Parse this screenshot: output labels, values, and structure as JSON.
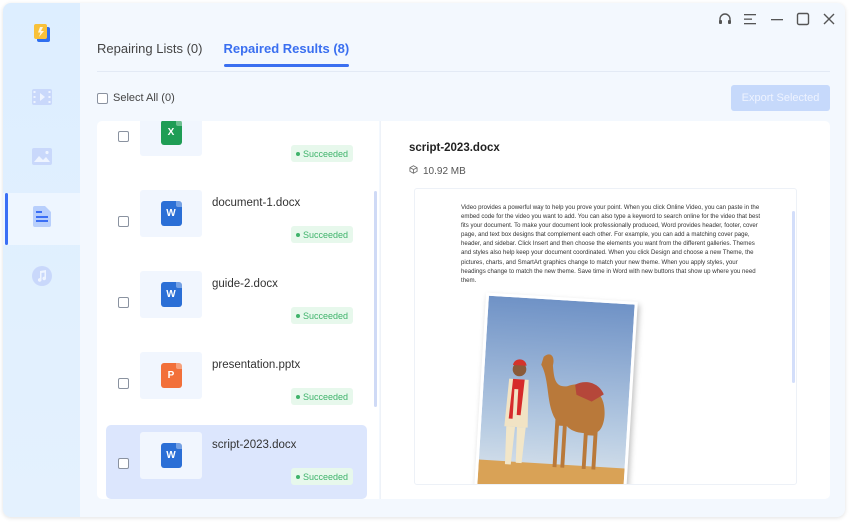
{
  "sidebar": {
    "items": [
      {
        "name": "app-logo",
        "icon": "app-logo-icon",
        "active": false
      },
      {
        "name": "video-repair",
        "icon": "film-icon",
        "active": false
      },
      {
        "name": "photo-repair",
        "icon": "image-icon",
        "active": false
      },
      {
        "name": "document-repair",
        "icon": "document-icon",
        "active": true
      },
      {
        "name": "audio-repair",
        "icon": "music-note-icon",
        "active": false
      }
    ]
  },
  "titlebar": {
    "icons": [
      "headset-icon",
      "menu-icon",
      "minimize-icon",
      "maximize-icon",
      "close-icon"
    ]
  },
  "tabs": [
    {
      "label": "Repairing Lists (0)",
      "active": false
    },
    {
      "label": "Repaired Results (8)",
      "active": true
    }
  ],
  "toolbar": {
    "select_all_label": "Select All (0)",
    "export_label": "Export Selected"
  },
  "files": [
    {
      "name": "",
      "type": "xlsx",
      "icon_letter": "X",
      "color": "#1f9d55",
      "status": "Succeeded",
      "selected": false
    },
    {
      "name": "document-1.docx",
      "type": "docx",
      "icon_letter": "W",
      "color": "#2b6fd6",
      "status": "Succeeded",
      "selected": false
    },
    {
      "name": "guide-2.docx",
      "type": "docx",
      "icon_letter": "W",
      "color": "#2b6fd6",
      "status": "Succeeded",
      "selected": false
    },
    {
      "name": "presentation.pptx",
      "type": "pptx",
      "icon_letter": "P",
      "color": "#f2703a",
      "status": "Succeeded",
      "selected": false
    },
    {
      "name": "script-2023.docx",
      "type": "docx",
      "icon_letter": "W",
      "color": "#2b6fd6",
      "status": "Succeeded",
      "selected": true
    }
  ],
  "detail": {
    "title": "script-2023.docx",
    "size": "10.92 MB",
    "preview_text": "Video provides a powerful way to help you prove your point. When you click Online Video, you can paste in the embed code for the video you want to add. You can also type a keyword to search online for the video that best fits your document. To make your document look professionally produced, Word provides header, footer, cover page, and text box designs that complement each other. For example, you can add a matching cover page, header, and sidebar. Click Insert and then choose the elements you want from the different galleries. Themes and styles also help keep your document coordinated. When you click Design and choose a new Theme, the pictures, charts, and SmartArt graphics change to match your new theme. When you apply styles, your headings change to match the new theme. Save time in Word with new buttons that show up where you need them.",
    "preview_image": "man-with-camel-in-desert-photo"
  },
  "colors": {
    "accent": "#3a6ff0",
    "success": "#3fb36b",
    "selected_row": "#dce6fd"
  }
}
